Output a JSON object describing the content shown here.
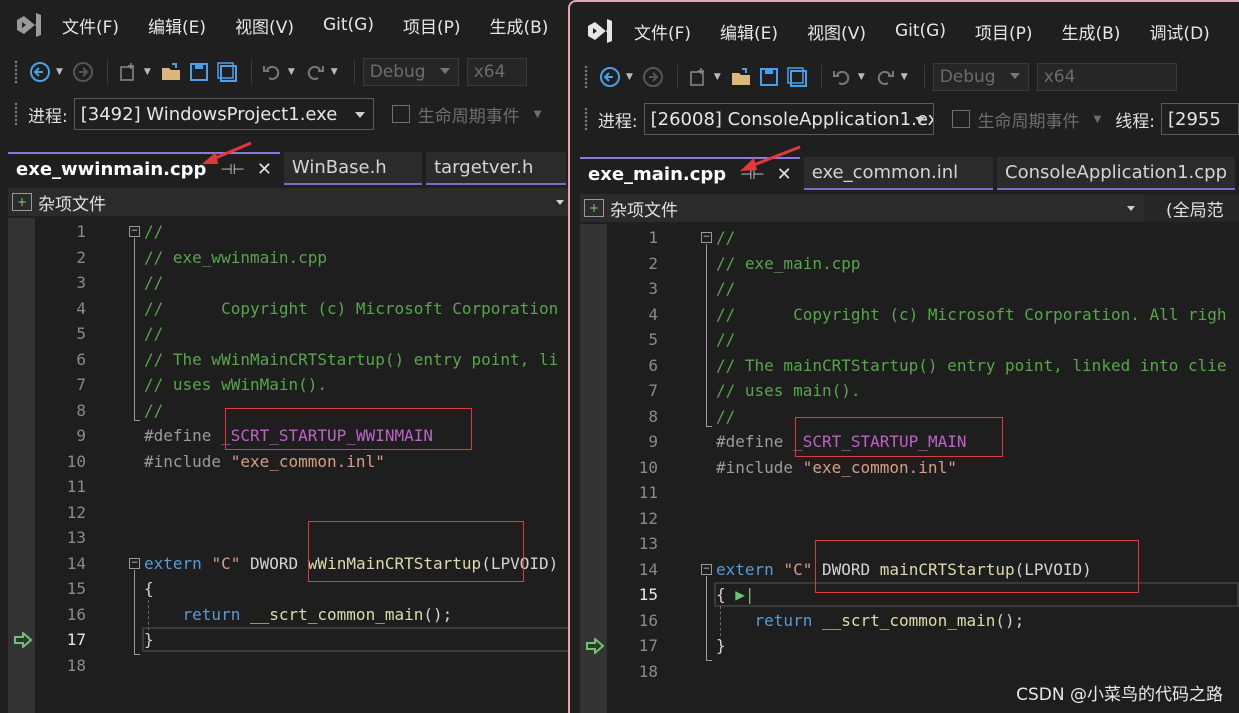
{
  "left": {
    "menu": [
      "文件(F)",
      "编辑(E)",
      "视图(V)",
      "Git(G)",
      "项目(P)",
      "生成(B)"
    ],
    "config": "Debug",
    "platform": "x64",
    "process_label": "进程:",
    "process_value": "[3492] WindowsProject1.exe",
    "lifecycle": "生命周期事件",
    "tabs": [
      {
        "label": "exe_wwinmain.cpp",
        "active": true
      },
      {
        "label": "WinBase.h",
        "active": false
      },
      {
        "label": "targetver.h",
        "active": false
      }
    ],
    "nav_scope": "杂项文件",
    "line_numbers": [
      "1",
      "2",
      "3",
      "4",
      "5",
      "6",
      "7",
      "8",
      "9",
      "10",
      "11",
      "12",
      "13",
      "14",
      "15",
      "16",
      "17",
      "18"
    ],
    "code": {
      "l1": "//",
      "l2": "// exe_wwinmain.cpp",
      "l3": "//",
      "l4": "//      Copyright (c) Microsoft Corporation",
      "l5": "//",
      "l6": "// The wWinMainCRTStartup() entry point, li",
      "l7": "// uses wWinMain().",
      "l8": "//",
      "l9_pp": "#define",
      "l9_mac": "_SCRT_STARTUP_WWINMAIN",
      "l10_pp": "#include",
      "l10_str": "\"exe_common.inl\"",
      "l14_kw": "extern",
      "l14_str": "\"C\"",
      "l14_type": "DWORD",
      "l14_fn": "wWinMainCRTStartup",
      "l14_rest": "(LPVOID)",
      "l15": "{",
      "l16_kw": "return",
      "l16_fn": "__scrt_common_main",
      "l16_rest": "();",
      "l17": "}"
    }
  },
  "right": {
    "menu": [
      "文件(F)",
      "编辑(E)",
      "视图(V)",
      "Git(G)",
      "项目(P)",
      "生成(B)",
      "调试(D)"
    ],
    "config": "Debug",
    "platform": "x64",
    "process_label": "进程:",
    "process_value": "[26008] ConsoleApplication1.ex",
    "lifecycle": "生命周期事件",
    "thread_label": "线程:",
    "thread_value": "[2955",
    "tabs": [
      {
        "label": "exe_main.cpp",
        "active": true
      },
      {
        "label": "exe_common.inl",
        "active": false
      },
      {
        "label": "ConsoleApplication1.cpp",
        "active": false
      }
    ],
    "nav_scope": "杂项文件",
    "nav_scope2": "(全局范",
    "line_numbers": [
      "1",
      "2",
      "3",
      "4",
      "5",
      "6",
      "7",
      "8",
      "9",
      "10",
      "11",
      "12",
      "13",
      "14",
      "15",
      "16",
      "17",
      "18"
    ],
    "code": {
      "l1": "//",
      "l2": "// exe_main.cpp",
      "l3": "//",
      "l4": "//      Copyright (c) Microsoft Corporation. All righ",
      "l5": "//",
      "l6": "// The mainCRTStartup() entry point, linked into clie",
      "l7": "// uses main().",
      "l8": "//",
      "l9_pp": "#define",
      "l9_mac": "_SCRT_STARTUP_MAIN",
      "l10_pp": "#include",
      "l10_str": "\"exe_common.inl\"",
      "l14_kw": "extern",
      "l14_str": "\"C\"",
      "l14_type": "DWORD",
      "l14_fn": "mainCRTStartup",
      "l14_rest": "(LPVOID)",
      "l15": "{",
      "l16_kw": "return",
      "l16_fn": "__scrt_common_main",
      "l16_rest": "();",
      "l17": "}"
    }
  },
  "watermark": "CSDN @小菜鸟的代码之路",
  "colors": {
    "accent": "#8b7ad8",
    "annotation": "#e0393a",
    "comment": "#57a64a",
    "keyword": "#569cd6",
    "string": "#d69d85",
    "function": "#dcdcaa",
    "macro": "#bd63c5"
  }
}
